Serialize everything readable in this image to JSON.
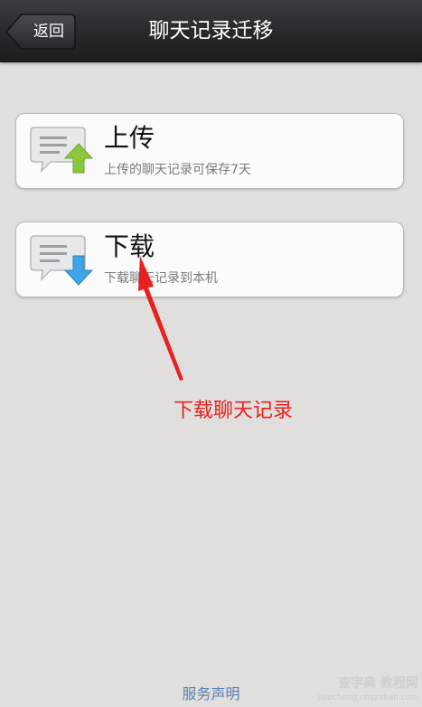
{
  "header": {
    "back_label": "返回",
    "title": "聊天记录迁移"
  },
  "options": [
    {
      "title": "上传",
      "subtitle": "上传的聊天记录可保存7天",
      "icon": "chat-upload-icon",
      "arrow_color": "#8cc63f"
    },
    {
      "title": "下载",
      "subtitle": "下载聊天记录到本机",
      "icon": "chat-download-icon",
      "arrow_color": "#3fa4e8"
    }
  ],
  "annotation": {
    "text": "下载聊天记录",
    "color": "#e8201e"
  },
  "footer": {
    "link_label": "服务声明"
  },
  "watermark": {
    "line1": "查字典 教程网",
    "line2": "jiaocheng.chazidian.com"
  }
}
